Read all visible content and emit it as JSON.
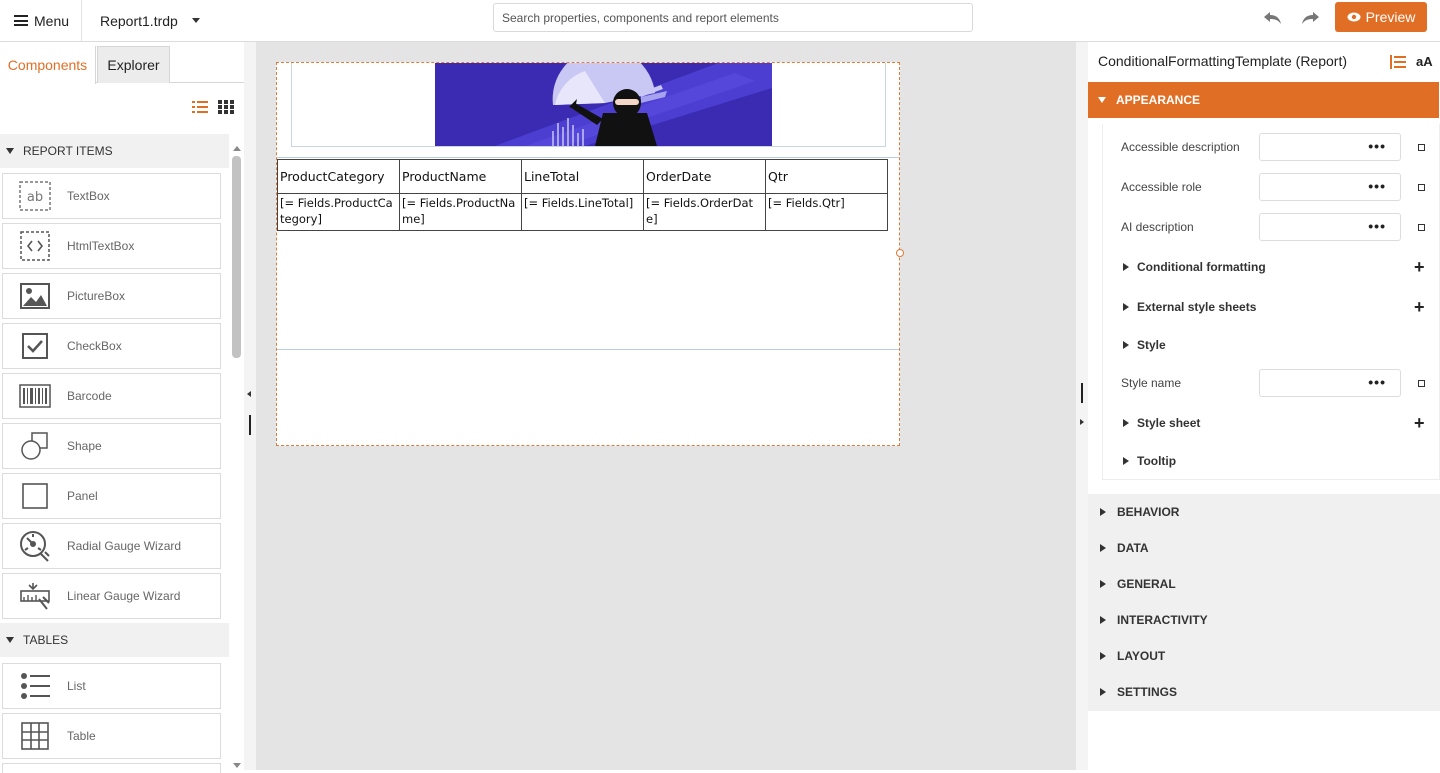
{
  "topbar": {
    "menu_label": "Menu",
    "file_name": "Report1.trdp",
    "search_placeholder": "Search properties, components and report elements",
    "preview_label": "Preview",
    "accent_color": "#e06f25"
  },
  "left_panel": {
    "tabs": [
      "Components",
      "Explorer"
    ],
    "sections": {
      "report_items": "REPORT ITEMS",
      "tables": "TABLES"
    },
    "report_items": [
      "TextBox",
      "HtmlTextBox",
      "PictureBox",
      "CheckBox",
      "Barcode",
      "Shape",
      "Panel",
      "Radial Gauge Wizard",
      "Linear Gauge Wizard"
    ],
    "table_items": [
      "List",
      "Table"
    ]
  },
  "report": {
    "headers": [
      "ProductCategory",
      "ProductName",
      "LineTotal",
      "OrderDate",
      "Qtr"
    ],
    "fields": [
      "[= Fields.ProductCategory]",
      "[= Fields.ProductName]",
      "[= Fields.LineTotal]",
      "[= Fields.OrderDate]",
      "[= Fields.Qtr]"
    ]
  },
  "properties": {
    "title": "ConditionalFormattingTemplate (Report)",
    "font_toggle": "aA",
    "open_category": "APPEARANCE",
    "rows": {
      "accessible_description": "Accessible description",
      "accessible_role": "Accessible role",
      "ai_description": "AI description",
      "conditional_formatting": "Conditional formatting",
      "external_style_sheets": "External style sheets",
      "style": "Style",
      "style_name": "Style name",
      "style_sheet": "Style sheet",
      "tooltip": "Tooltip"
    },
    "categories": [
      "BEHAVIOR",
      "DATA",
      "GENERAL",
      "INTERACTIVITY",
      "LAYOUT",
      "SETTINGS"
    ]
  }
}
